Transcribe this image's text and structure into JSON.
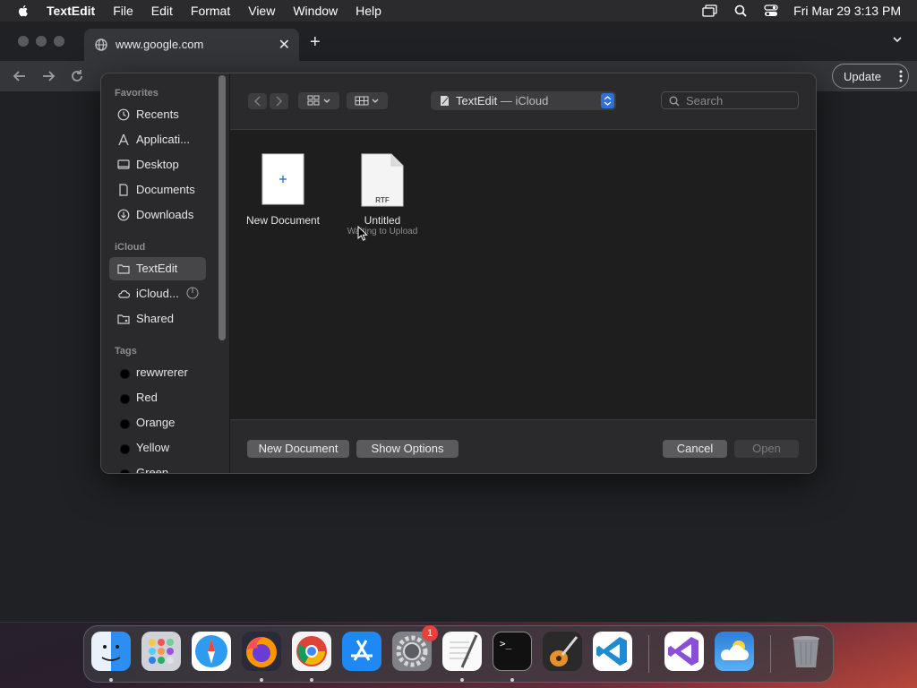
{
  "menubar": {
    "app_name": "TextEdit",
    "items": [
      "File",
      "Edit",
      "Format",
      "View",
      "Window",
      "Help"
    ],
    "clock": "Fri Mar 29  3:13 PM"
  },
  "browser": {
    "tab_title": "www.google.com",
    "tab_close": "✕",
    "new_tab": "+",
    "update_label": "Update"
  },
  "dialog": {
    "sidebar": {
      "favorites_heading": "Favorites",
      "favorites": [
        "Recents",
        "Applicati...",
        "Desktop",
        "Documents",
        "Downloads"
      ],
      "icloud_heading": "iCloud",
      "icloud": [
        "TextEdit",
        "iCloud...",
        "Shared"
      ],
      "tags_heading": "Tags",
      "tags": [
        "rewwrerer",
        "Red",
        "Orange",
        "Yellow",
        "Green"
      ]
    },
    "location": {
      "app": "TextEdit",
      "sep": " — ",
      "place": "iCloud"
    },
    "search_placeholder": "Search",
    "files": [
      {
        "name": "New Document",
        "status": ""
      },
      {
        "name": "Untitled",
        "status": "Waiting to Upload",
        "badge": "RTF"
      }
    ],
    "buttons": {
      "new_document": "New Document",
      "show_options": "Show Options",
      "cancel": "Cancel",
      "open": "Open"
    }
  },
  "dock": {
    "apps": [
      "finder-icon",
      "launchpad-icon",
      "safari-icon",
      "firefox-icon",
      "chrome-icon",
      "app-store-icon",
      "system-settings-icon",
      "textedit-icon",
      "terminal-icon",
      "garageband-icon",
      "vscode-icon",
      "visual-studio-icon",
      "weather-icon",
      "trash-icon"
    ],
    "settings_badge": "1",
    "terminal_prompt": ">_"
  },
  "colors": {
    "accent": "#2f6fd8",
    "badge": "#e5423b"
  }
}
